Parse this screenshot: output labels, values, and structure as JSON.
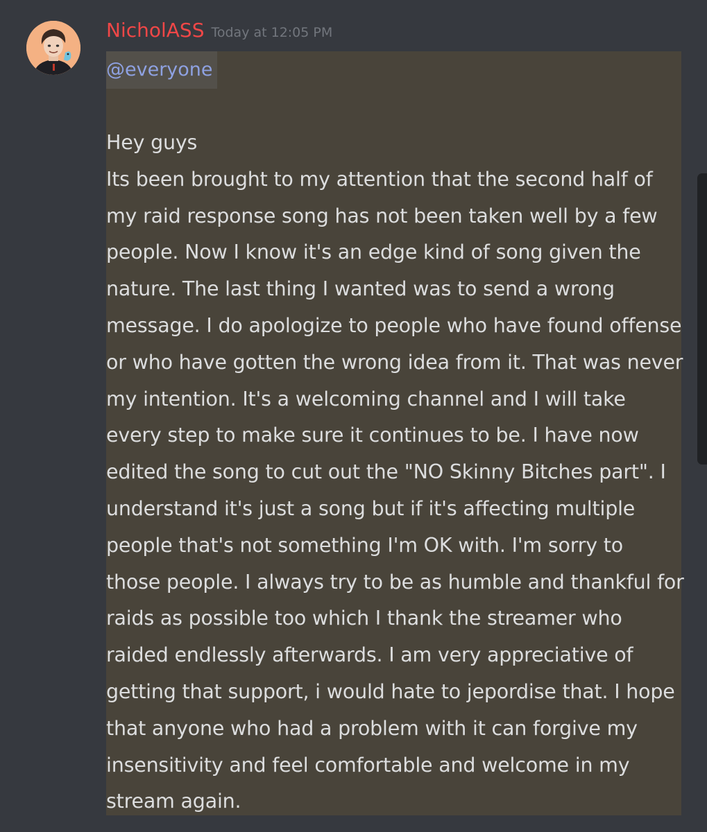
{
  "message": {
    "author": "NicholASS",
    "timestamp": "Today at 12:05 PM",
    "mention": "@everyone",
    "lines": [
      "Hey guys",
      "Its been brought to my attention that the second half of",
      "my raid response song has not been taken well by a few",
      "people. Now I know it's an edge kind of song given the",
      "nature. The last thing I wanted was to send a wrong",
      "message. I do apologize to people who have found offense",
      "or who have gotten the wrong idea from it. That was never",
      "my intention. It's a welcoming channel and I will take",
      "every step to make sure it continues to be. I have now",
      "edited the song to cut out the \"NO Skinny Bitches part\". I",
      "understand it's just a song but if it's affecting multiple",
      "people that's not something I'm OK with. I'm sorry to",
      "those people. I always try to be as humble and thankful for",
      "raids as possible too which I thank the streamer who",
      "raided endlessly afterwards. I am very appreciative of",
      "getting that support, i would hate to jepordise that. I hope",
      "that anyone who had a problem with it can forgive my",
      "insensitivity and feel comfortable and welcome in my",
      "stream again."
    ]
  },
  "colors": {
    "background": "#36393f",
    "author": "#f04747",
    "timestamp": "#72767d",
    "mention": "#8ea1e1",
    "highlight": "#49443a",
    "text": "#dcddde"
  },
  "icons": {
    "avatar": "user-avatar-icon"
  }
}
